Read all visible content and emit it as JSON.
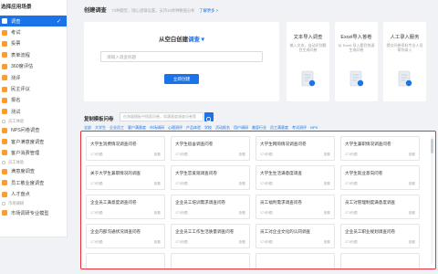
{
  "sidebar": {
    "title": "选择应用场景",
    "items": [
      {
        "label": "调查",
        "active": true
      },
      {
        "label": "考试",
        "nested": true
      },
      {
        "label": "投票"
      },
      {
        "label": "表单流程"
      },
      {
        "label": "360度评估"
      },
      {
        "label": "测评"
      },
      {
        "label": "民主评议"
      },
      {
        "label": "报名"
      },
      {
        "label": "测试"
      },
      {
        "label": "员工体验",
        "category": true
      },
      {
        "label": "NPS问卷调查"
      },
      {
        "label": "客户满意度调查"
      },
      {
        "label": "客户消费管理"
      },
      {
        "label": "员工体验",
        "category": true
      },
      {
        "label": "满意度调查"
      },
      {
        "label": "员工敬业度调查"
      },
      {
        "label": "人才盘点"
      },
      {
        "label": "市场调研",
        "category": true
      },
      {
        "label": "市场调研专业模型"
      }
    ]
  },
  "create": {
    "title": "创建调查",
    "tip": "73种题型，随心逻辑设置，支持10余种数据分析",
    "link": "了解更多 >",
    "blank_title_prefix": "从空白创建",
    "blank_title_type": "调查",
    "input_placeholder": "请输入调查标题",
    "create_btn": "立即创建"
  },
  "imports": [
    {
      "title": "文本导入调查",
      "desc": "输入文本，自动识别题目生成问卷"
    },
    {
      "title": "Excel导入答卷",
      "desc": "从 Excel 导入题目快速生成问卷"
    },
    {
      "title": "人工录入服务",
      "desc": "提交问卷资料专业人员帮你录入"
    }
  ],
  "templates": {
    "title": "复制模板问卷",
    "search_placeholder": "在海量模板中搜索问卷，如满意度调查问卷等",
    "tags": [
      "全部",
      "大学生",
      "企业员工",
      "客户满意度",
      "市场调研",
      "心理测评",
      "产品体验",
      "学校",
      "活动报名",
      "用户调研",
      "美容行业",
      "员工满意度",
      "考试测评",
      "NPS"
    ],
    "cards": [
      {
        "title": "大学生消费情况调查问卷",
        "meta": "171份题",
        "pick": "查看"
      },
      {
        "title": "大学生宿舍调查问卷",
        "meta": "171份题",
        "pick": "查看"
      },
      {
        "title": "大学生网购情况调查问卷",
        "meta": "171份题",
        "pick": "查看"
      },
      {
        "title": "大学生兼职情况调查问卷",
        "meta": "171份题",
        "pick": "查看"
      },
      {
        "title": "关于大学生兼职情况的调查",
        "meta": "171份题",
        "pick": "查看"
      },
      {
        "title": "大学生恋爱观调查问卷",
        "meta": "171份题",
        "pick": "查看"
      },
      {
        "title": "大学生生活满意度调查",
        "meta": "171份题",
        "pick": "查看"
      },
      {
        "title": "大学生就业意向问卷",
        "meta": "171份题",
        "pick": "查看"
      },
      {
        "title": "企业员工满意度调查问卷",
        "meta": "171份题",
        "pick": "查看"
      },
      {
        "title": "企业员工培训需求调查问卷",
        "meta": "171份题",
        "pick": "查看"
      },
      {
        "title": "员工福利需求调查问卷",
        "meta": "171份题",
        "pick": "查看"
      },
      {
        "title": "员工对管理制度满意度调查",
        "meta": "171份题",
        "pick": "查看"
      },
      {
        "title": "企业内部沟通状况调查问卷",
        "meta": "171份题",
        "pick": "查看"
      },
      {
        "title": "企业员工工作生活质量调查问卷",
        "meta": "171份题",
        "pick": "查看"
      },
      {
        "title": "员工对企业文化的认同调查",
        "meta": "171份题",
        "pick": "查看"
      },
      {
        "title": "企业员工职业规划调查问卷",
        "meta": "171份题",
        "pick": "查看"
      },
      {
        "title": "",
        "meta": "",
        "pick": ""
      },
      {
        "title": "",
        "meta": "",
        "pick": ""
      },
      {
        "title": "",
        "meta": "",
        "pick": ""
      },
      {
        "title": "",
        "meta": "",
        "pick": ""
      }
    ]
  },
  "colors": {
    "accent": "#1a73e8",
    "highlight": "#e8303d",
    "sidebar_icon": "#ff9b2d"
  }
}
